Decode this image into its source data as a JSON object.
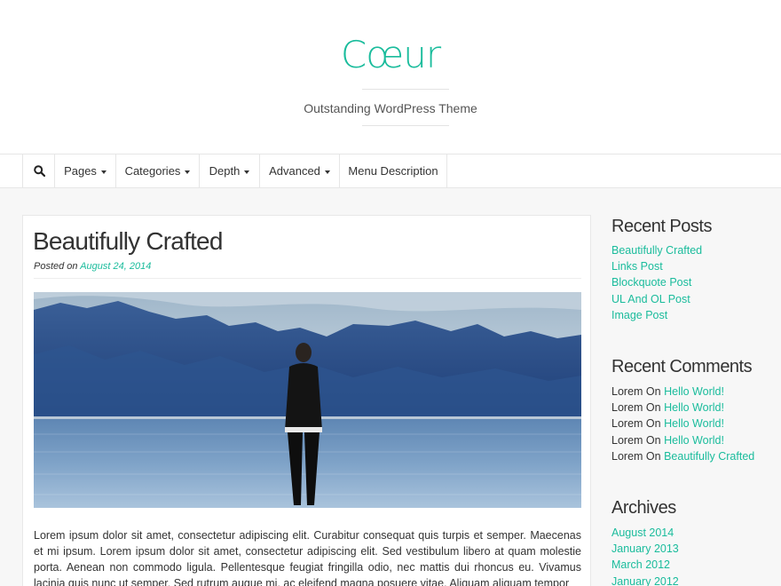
{
  "header": {
    "site_title": "Cœur",
    "tagline": "Outstanding WordPress Theme"
  },
  "nav": {
    "search_icon": "search-icon",
    "items": [
      {
        "label": "Pages",
        "has_caret": true
      },
      {
        "label": "Categories",
        "has_caret": true
      },
      {
        "label": "Depth",
        "has_caret": true
      },
      {
        "label": "Advanced",
        "has_caret": true
      },
      {
        "label": "Menu Description",
        "has_caret": false
      }
    ]
  },
  "post": {
    "title": "Beautifully Crafted",
    "meta_prefix": "Posted on",
    "date": "August 24, 2014",
    "excerpt": "Lorem ipsum dolor sit amet, consectetur adipiscing elit. Curabitur consequat quis turpis et semper. Maecenas et mi ipsum. Lorem ipsum dolor sit amet, consectetur adipiscing elit. Sed vestibulum libero at quam molestie porta. Aenean non commodo ligula. Pellentesque feugiat fringilla odio, nec mattis dui rhoncus eu. Vivamus lacinia quis nunc ut semper. Sed rutrum augue mi, ac eleifend magna posuere vitae. Aliquam aliquam tempor"
  },
  "sidebar": {
    "recent_posts": {
      "title": "Recent Posts",
      "items": [
        "Beautifully Crafted",
        "Links Post",
        "Blockquote Post",
        "UL And OL Post",
        "Image Post"
      ]
    },
    "recent_comments": {
      "title": "Recent Comments",
      "items": [
        {
          "author": "Lorem",
          "on": "On",
          "post": "Hello World!"
        },
        {
          "author": "Lorem",
          "on": "On",
          "post": "Hello World!"
        },
        {
          "author": "Lorem",
          "on": "On",
          "post": "Hello World!"
        },
        {
          "author": "Lorem",
          "on": "On",
          "post": "Hello World!"
        },
        {
          "author": "Lorem",
          "on": "On",
          "post": "Beautifully Crafted"
        }
      ]
    },
    "archives": {
      "title": "Archives",
      "items": [
        "August 2014",
        "January 2013",
        "March 2012",
        "January 2012"
      ]
    }
  },
  "colors": {
    "accent": "#1abc9c",
    "text": "#333333",
    "background": "#f7f7f7"
  }
}
